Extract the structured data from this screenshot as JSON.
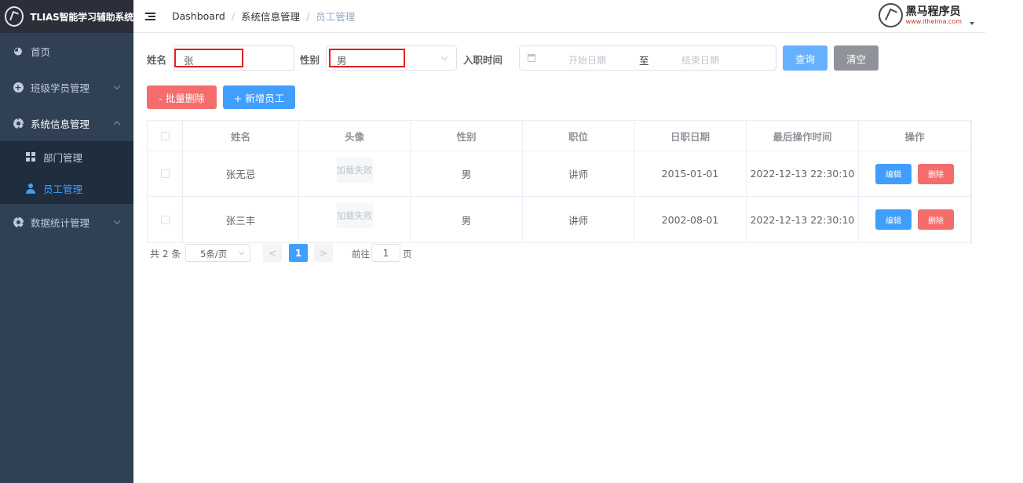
{
  "app": {
    "title": "TLIAS智能学习辅助系统"
  },
  "sidebar": {
    "items": [
      {
        "label": "首页",
        "icon": "dashboard-icon"
      },
      {
        "label": "班级学员管理",
        "icon": "plus-circle-icon"
      },
      {
        "label": "系统信息管理",
        "icon": "gear-icon",
        "children": [
          {
            "label": "部门管理",
            "icon": "grid-icon"
          },
          {
            "label": "员工管理",
            "icon": "user-icon",
            "active": true
          }
        ]
      },
      {
        "label": "数据统计管理",
        "icon": "gear-icon"
      }
    ]
  },
  "header": {
    "breadcrumb": [
      "Dashboard",
      "系统信息管理",
      "员工管理"
    ],
    "brand": {
      "name": "黑马程序员",
      "url": "www.itheima.com"
    }
  },
  "search": {
    "name_label": "姓名",
    "name_value": "张",
    "gender_label": "性别",
    "gender_value": "男",
    "date_label": "入职时间",
    "start_placeholder": "开始日期",
    "range_separator": "至",
    "end_placeholder": "结束日期",
    "query_label": "查询",
    "clear_label": "清空"
  },
  "actions": {
    "batch_delete_label": "- 批量删除",
    "add_label": "+ 新增员工"
  },
  "table": {
    "headers": [
      "姓名",
      "头像",
      "性别",
      "职位",
      "日职日期",
      "最后操作时间",
      "操作"
    ],
    "rows": [
      {
        "name": "张无忌",
        "avatar": "加载失败",
        "gender": "男",
        "job": "讲师",
        "entry_date": "2015-01-01",
        "update_time": "2022-12-13 22:30:10",
        "edit": "编辑",
        "delete": "删除"
      },
      {
        "name": "张三丰",
        "avatar": "加载失败",
        "gender": "男",
        "job": "讲师",
        "entry_date": "2002-08-01",
        "update_time": "2022-12-13 22:30:10",
        "edit": "编辑",
        "delete": "删除"
      }
    ]
  },
  "pagination": {
    "total_text": "共 2 条",
    "page_size": "5条/页",
    "prev": "<",
    "current_page": "1",
    "next": ">",
    "goto_prefix": "前往",
    "goto_value": "1",
    "goto_suffix": "页"
  },
  "colors": {
    "sidebar_bg": "#304156",
    "primary": "#409eff",
    "danger": "#f56c6c",
    "info": "#909399"
  }
}
